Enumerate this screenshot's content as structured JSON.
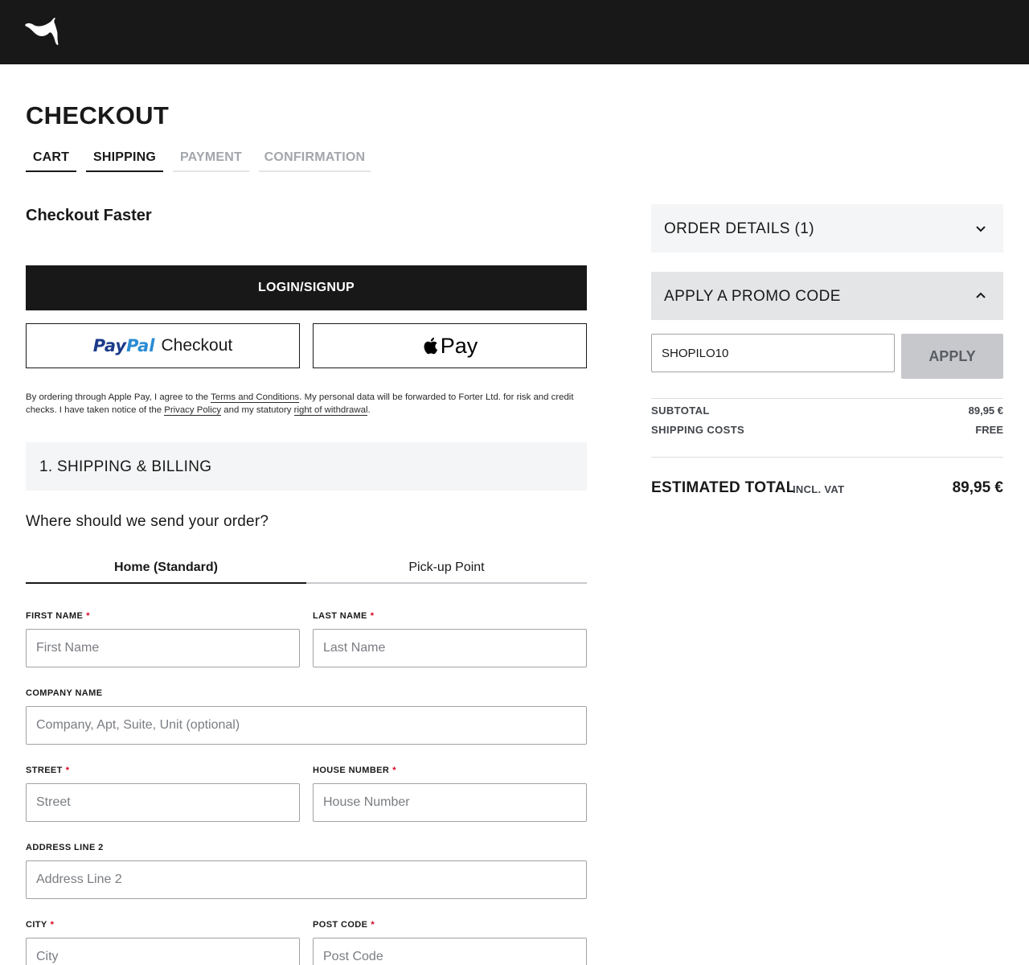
{
  "brand": {
    "logo_icon": "puma-cat-logo"
  },
  "page": {
    "title": "CHECKOUT"
  },
  "steps": [
    {
      "label": "CART",
      "state": "completed"
    },
    {
      "label": "SHIPPING",
      "state": "current"
    },
    {
      "label": "PAYMENT",
      "state": "upcoming"
    },
    {
      "label": "CONFIRMATION",
      "state": "upcoming"
    }
  ],
  "checkout_faster": {
    "heading": "Checkout Faster",
    "login_label": "LOGIN/SIGNUP",
    "paypal": {
      "brand_pay": "Pay",
      "brand_pal": "Pal",
      "label": "Checkout"
    },
    "applepay": {
      "label": "Pay",
      "icon": "apple-icon"
    }
  },
  "legal": {
    "text1": "By ordering through Apple Pay, I agree to the ",
    "terms_link": "Terms and Conditions",
    "text2": ". My personal data will be forwarded to Forter Ltd. for risk and credit checks. I have taken notice of the ",
    "privacy_link": "Privacy Policy",
    "text3": " and my statutory ",
    "withdrawal_link": "right of withdrawal",
    "text4": "."
  },
  "shipping_section": {
    "header": "1. SHIPPING & BILLING",
    "question": "Where should we send your order?",
    "tabs": [
      {
        "label": "Home (Standard)",
        "active": true
      },
      {
        "label": "Pick-up Point",
        "active": false
      }
    ]
  },
  "form": {
    "first_name": {
      "label": "FIRST NAME",
      "required": "*",
      "placeholder": "First Name",
      "value": ""
    },
    "last_name": {
      "label": "LAST NAME",
      "required": "*",
      "placeholder": "Last Name",
      "value": ""
    },
    "company": {
      "label": "COMPANY NAME",
      "placeholder": "Company, Apt, Suite, Unit (optional)",
      "value": ""
    },
    "street": {
      "label": "STREET",
      "required": "*",
      "placeholder": "Street",
      "value": ""
    },
    "house_number": {
      "label": "HOUSE NUMBER",
      "required": "*",
      "placeholder": "House Number",
      "value": ""
    },
    "address2": {
      "label": "ADDRESS LINE 2",
      "placeholder": "Address Line 2",
      "value": ""
    },
    "city": {
      "label": "CITY",
      "required": "*",
      "placeholder": "City",
      "value": ""
    },
    "post_code": {
      "label": "POST CODE",
      "required": "*",
      "placeholder": "Post Code",
      "value": ""
    }
  },
  "sidebar": {
    "order_details": {
      "label": "ORDER DETAILS (1)",
      "icon": "chevron-down-icon",
      "expanded": false
    },
    "promo": {
      "label": "APPLY A PROMO CODE",
      "icon": "chevron-up-icon",
      "expanded": true,
      "input_value": "SHOPILO10",
      "apply_label": "APPLY"
    },
    "summary": {
      "subtotal_label": "SUBTOTAL",
      "subtotal_value": "89,95 €",
      "shipping_label": "SHIPPING COSTS",
      "shipping_value": "FREE",
      "total_label": "ESTIMATED TOTAL",
      "total_note": "INCL. VAT",
      "total_value": "89,95 €"
    }
  },
  "colors": {
    "header_bg": "#181818",
    "accent_dark": "#191919",
    "required": "#d6001c",
    "inactive_step": "#a3a6ab",
    "paypal_dark": "#1b3b8a",
    "paypal_light": "#2a8cd3"
  }
}
